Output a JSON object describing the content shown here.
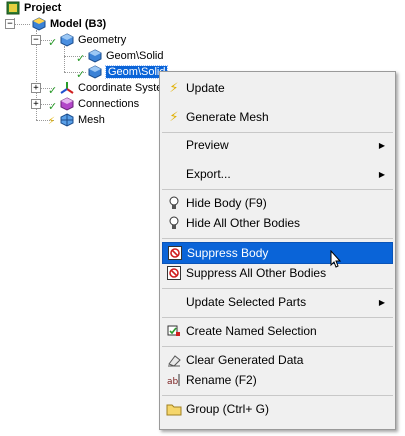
{
  "tree": {
    "project": "Project",
    "model": "Model (B3)",
    "geometry": "Geometry",
    "geom1": "Geom\\Solid",
    "geom2": "Geom\\Solid",
    "coordinate_systems": "Coordinate Syste",
    "connections": "Connections",
    "mesh": "Mesh"
  },
  "menu": {
    "update": "Update",
    "generate_mesh": "Generate Mesh",
    "preview": "Preview",
    "export": "Export...",
    "hide_body": "Hide Body (F9)",
    "hide_all_other": "Hide All Other Bodies",
    "suppress_body": "Suppress Body",
    "suppress_all_other": "Suppress All Other Bodies",
    "update_selected": "Update Selected Parts",
    "create_named": "Create Named Selection",
    "clear_generated": "Clear Generated Data",
    "rename": "Rename (F2)",
    "group": "Group (Ctrl+ G)"
  },
  "colors": {
    "highlight": "#0a64d8",
    "menu_bg": "#f0f0f0",
    "check_green": "#2a9b2a",
    "bolt_yellow": "#e0b000"
  }
}
